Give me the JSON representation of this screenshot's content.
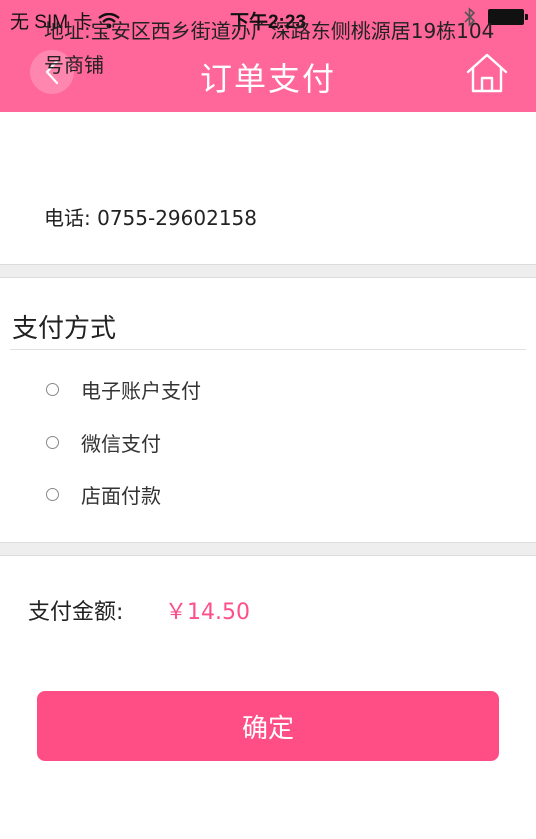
{
  "status_bar": {
    "carrier": "无 SIM 卡",
    "time": "下午2:23"
  },
  "nav": {
    "title": "订单支付",
    "back_icon": "chevron-left-icon",
    "home_icon": "home-icon"
  },
  "store": {
    "address": "地址:宝安区西乡街道办广深路东侧桃源居19栋104号商铺",
    "phone": "电话: 0755-29602158"
  },
  "payment": {
    "title": "支付方式",
    "options": [
      {
        "label": "电子账户支付",
        "selected": false
      },
      {
        "label": "微信支付",
        "selected": false
      },
      {
        "label": "店面付款",
        "selected": false
      }
    ]
  },
  "amount": {
    "label": "支付金额:",
    "value": "￥14.50"
  },
  "confirm_label": "确定",
  "colors": {
    "brand": "#ff6699",
    "button": "#ff4d86",
    "amount": "#ff4f8b"
  }
}
